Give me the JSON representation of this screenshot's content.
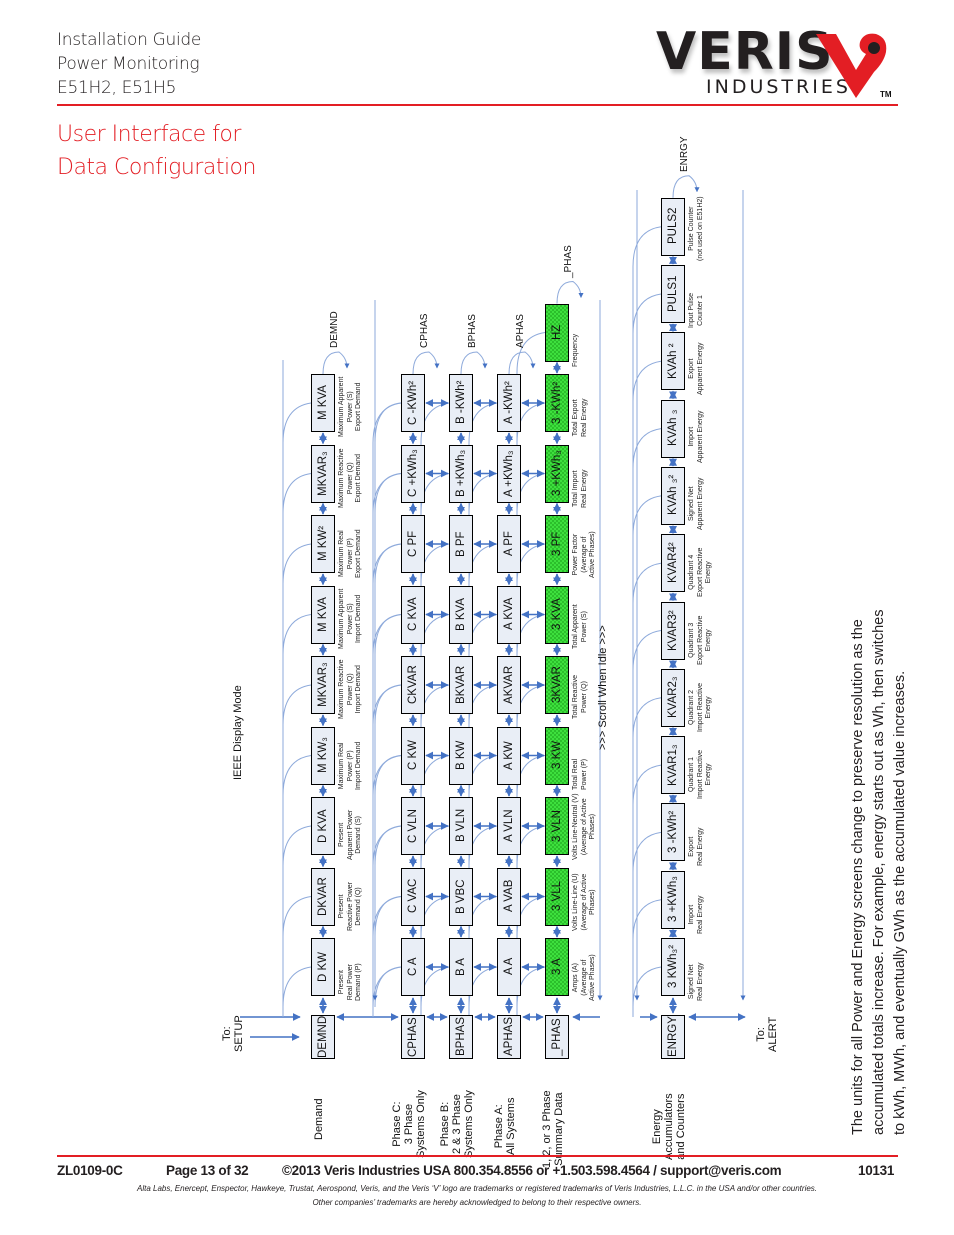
{
  "header": {
    "lines": [
      "Installation Guide",
      "Power Monitoring",
      "E51H2, E51H5"
    ],
    "title_lines": [
      "User Interface for",
      "Data Configuration"
    ],
    "logo": {
      "name": "VERIS",
      "sub": "INDUSTRIES",
      "tm": "TM",
      "accent": "#e31e24"
    }
  },
  "diagram": {
    "mode_label": "IEEE Display Mode",
    "scroll_label": ">>>  Scroll When Idle  >>>",
    "to_setup": [
      "To:",
      "SETUP"
    ],
    "to_alert": [
      "To:",
      "ALERT"
    ],
    "colors": {
      "arrow": "#4472c4",
      "box": "#e9eef6",
      "summary": "#3ee03e"
    },
    "rows": [
      {
        "id": "demand",
        "head": "DEMND",
        "label": [
          "Demand"
        ],
        "return_label": "DEMND",
        "green": false,
        "items": [
          {
            "box": "D    KW",
            "cap": [
              "Present",
              "Real Power",
              "Demand (P)"
            ]
          },
          {
            "box": "DKVAR",
            "cap": [
              "Present",
              "Reactive Power",
              "Demand (Q)"
            ]
          },
          {
            "box": "D KVA",
            "cap": [
              "Present",
              "Apparent Power",
              "Demand (S)"
            ]
          },
          {
            "box": "M    KW₃",
            "cap": [
              "Maximum Real",
              "Power (P)",
              "Import Demand"
            ]
          },
          {
            "box": "MKVAR₃",
            "cap": [
              "Maximum Reactive",
              "Power (Q)",
              "Import Demand"
            ]
          },
          {
            "box": "M KVA",
            "cap": [
              "Maximum Apparent",
              "Power (S)",
              "Import Demand"
            ]
          },
          {
            "box": "M    KW²",
            "cap": [
              "Maximum Real",
              "Power (P)",
              "Export Demand"
            ]
          },
          {
            "box": "MKVAR₃",
            "cap": [
              "Maximum Reactive",
              "Power (Q)",
              "Export Demand"
            ]
          },
          {
            "box": "M  KVA",
            "cap": [
              "Maximum Apparent",
              "Power (S)",
              "Export Demand"
            ]
          }
        ]
      },
      {
        "id": "phase-c",
        "head": "CPHAS",
        "label": [
          "Phase C:",
          "3 Phase",
          "Systems Only"
        ],
        "return_label": "CPHAS",
        "green": false,
        "items": [
          {
            "box": "C    A"
          },
          {
            "box": "C VAC"
          },
          {
            "box": "C VLN"
          },
          {
            "box": "C    KW"
          },
          {
            "box": "CKVAR"
          },
          {
            "box": "C  KVA"
          },
          {
            "box": "C    PF"
          },
          {
            "box": "C +KWh₃"
          },
          {
            "box": "C -KWh²"
          }
        ]
      },
      {
        "id": "phase-b",
        "head": "BPHAS",
        "label": [
          "Phase B:",
          "2 & 3 Phase",
          "Systems Only"
        ],
        "return_label": "BPHAS",
        "green": false,
        "items": [
          {
            "box": "B    A"
          },
          {
            "box": "B VBC"
          },
          {
            "box": "B VLN"
          },
          {
            "box": "B    KW"
          },
          {
            "box": "BKVAR"
          },
          {
            "box": "B  KVA"
          },
          {
            "box": "B    PF"
          },
          {
            "box": "B +KWh₃"
          },
          {
            "box": "B -KWh²"
          }
        ]
      },
      {
        "id": "phase-a",
        "head": "APHAS",
        "label": [
          "Phase A:",
          "All Systems"
        ],
        "return_label": "APHAS",
        "green": false,
        "items": [
          {
            "box": "A    A"
          },
          {
            "box": "A VAB"
          },
          {
            "box": "A VLN"
          },
          {
            "box": "A    KW"
          },
          {
            "box": "AKVAR"
          },
          {
            "box": "A  KVA"
          },
          {
            "box": "A    PF"
          },
          {
            "box": "A +KWh₃"
          },
          {
            "box": "A -KWh²"
          }
        ]
      },
      {
        "id": "summary",
        "head": "_PHAS",
        "label": [
          "1, 2, or 3 Phase",
          "Summary Data"
        ],
        "return_label": "_PHAS",
        "green": true,
        "items": [
          {
            "box": "3    A",
            "cap": [
              "Amps (A)",
              "(Average of",
              "Active Phases)"
            ]
          },
          {
            "box": "3  VLL",
            "cap": [
              "Volts Line-Line (U)",
              "(Average of Active",
              "Phases)"
            ]
          },
          {
            "box": "3  VLN",
            "cap": [
              "Volts Line-Neutral (V)",
              "(Average of Active",
              "Phases)"
            ]
          },
          {
            "box": "3    KW",
            "cap": [
              "Total Real",
              "Power (P)"
            ]
          },
          {
            "box": "3KVAR",
            "cap": [
              "Total Reactive",
              "Power (Q)"
            ]
          },
          {
            "box": "3  KVA",
            "cap": [
              "Total Apparent",
              "Power (S)"
            ]
          },
          {
            "box": "3    PF",
            "cap": [
              "Power Factor",
              "(Average of",
              "Active Phases)"
            ]
          },
          {
            "box": "3 +KWh₃",
            "cap": [
              "Total Import",
              "Real Energy"
            ]
          },
          {
            "box": "3 -KWh²",
            "cap": [
              "Total Export",
              "Real Energy"
            ]
          },
          {
            "box": "HZ",
            "cap": [
              "Frequency"
            ]
          }
        ]
      },
      {
        "id": "energy",
        "head": "ENRGY",
        "label": [
          "Energy",
          "Accumulators",
          "and Counters"
        ],
        "return_label": "ENRGY",
        "green": false,
        "items": [
          {
            "box": "3    KWh₃²",
            "cap": [
              "Signed Net",
              "Real Energy"
            ]
          },
          {
            "box": "3 +KWh₃",
            "cap": [
              "Import",
              "Real Energy"
            ]
          },
          {
            "box": "3 -KWh²",
            "cap": [
              "Export",
              "Real Energy"
            ]
          },
          {
            "box": "KVAR1₃",
            "cap": [
              "Quadrant 1",
              "Import Reactive",
              "Energy"
            ]
          },
          {
            "box": "KVAR2₃",
            "cap": [
              "Quadrant 2",
              "Import Reactive",
              "Energy"
            ]
          },
          {
            "box": "KVAR3²",
            "cap": [
              "Quadrant 3",
              "Export Reactive",
              "Energy"
            ]
          },
          {
            "box": "KVAR4²",
            "cap": [
              "Quadrant 4",
              "Export Reactive",
              "Energy"
            ]
          },
          {
            "box": "KVAh ₃²",
            "cap": [
              "Signed Net",
              "Apparent Energy"
            ]
          },
          {
            "box": "KVAh ₃",
            "cap": [
              "Import",
              "Apparent Energy"
            ]
          },
          {
            "box": "KVAh ²",
            "cap": [
              "Export",
              "Apparent Energy"
            ]
          },
          {
            "box": "PULS1",
            "cap": [
              "Input Pulse",
              "Counter 1"
            ]
          },
          {
            "box": "PULS2",
            "cap": [
              "Pulse Counter",
              "(not used on E51H2)"
            ]
          }
        ]
      }
    ]
  },
  "note": [
    "The units for all Power and Energy screens change to preserve resolution as the",
    "accumulated totals increase. For example, energy starts out as Wh, then switches",
    "to kWh, MWh, and eventually GWh as the accumulated value increases."
  ],
  "footer": {
    "doc_id": "ZL0109-0C",
    "page": "Page 13 of 32",
    "contact": "©2013 Veris Industries   USA 800.354.8556 or +1.503.598.4564  / support@veris.com",
    "code": "10131",
    "trademark_1": "Alta Labs, Enercept, Enspector, Hawkeye, Trustat, Aerospond, Veris, and the Veris ‘V’ logo are trademarks or registered trademarks of  Veris Industries, L.L.C. in the USA and/or other countries.",
    "trademark_2": "Other companies’ trademarks are hereby acknowledged to belong to their respective owners."
  }
}
